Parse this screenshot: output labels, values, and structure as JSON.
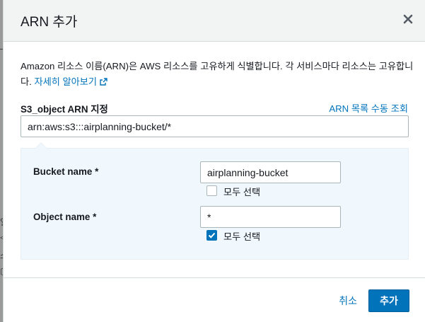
{
  "modal": {
    "title": "ARN 추가",
    "description": "Amazon 리소스 이름(ARN)은 AWS 리소스를 고유하게 식별합니다. 각 서비스마다 리소스는 고유합니다.",
    "learn_more": "자세히 알아보기",
    "arn_field": {
      "label": "S3_object ARN 지정",
      "list_link": "ARN 목록 수동 조회",
      "value": "arn:aws:s3:::airplanning-bucket/*"
    },
    "bucket": {
      "label": "Bucket name *",
      "value": "airplanning-bucket",
      "select_all_label": "모두 선택",
      "select_all_checked": false
    },
    "object": {
      "label": "Object name *",
      "value": "*",
      "select_all_label": "모두 선택",
      "select_all_checked": true
    },
    "footer": {
      "cancel_label": "취소",
      "add_label": "추가"
    }
  },
  "colors": {
    "link": "#0073bb",
    "primary_button": "#0073bb",
    "panel_background": "#f1f8fd",
    "header_background": "#f2f3f3"
  }
}
